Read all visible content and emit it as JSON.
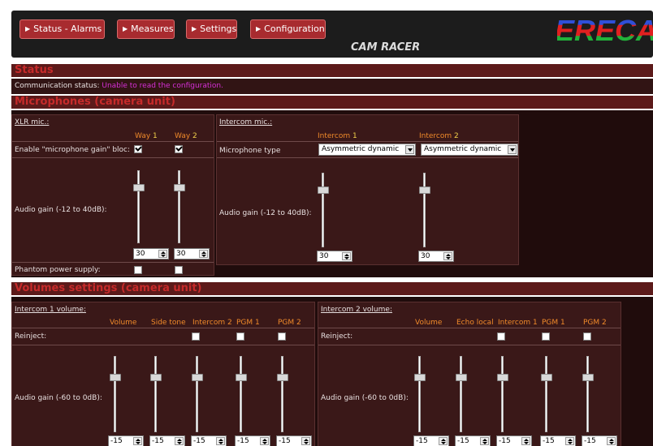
{
  "nav": {
    "status_alarms": "Status - Alarms",
    "measures": "Measures",
    "settings": "Settings",
    "configuration": "Configuration"
  },
  "header": {
    "device_name": "CAM RACER",
    "logo_text": "ERECA",
    "logo_colors": [
      "#2f4fd8",
      "#e02020",
      "#22b23a"
    ]
  },
  "status": {
    "section_title": "Status",
    "comm_label": "Communication status:",
    "comm_value": "Unable to read the configuration."
  },
  "microphones": {
    "section_title": "Microphones (camera unit)",
    "xlr": {
      "title": "XLR mic.:",
      "col_way1_prefix": "Way",
      "col_way1_num": "1",
      "col_way2_prefix": "Way",
      "col_way2_num": "2",
      "enable_label": "Enable \"microphone gain\" bloc:",
      "enable_way1": true,
      "enable_way2": true,
      "gain_label": "Audio gain (-12 to 40dB):",
      "gain_way1": "30",
      "gain_way2": "30",
      "phantom_label": "Phantom power supply:",
      "phantom_way1": false,
      "phantom_way2": false
    },
    "intercom": {
      "title": "Intercom mic.:",
      "col1_prefix": "Intercom",
      "col1_num": "1",
      "col2_prefix": "Intercom",
      "col2_num": "2",
      "type_label": "Microphone type",
      "type1": "Asymmetric dynamic",
      "type2": "Asymmetric dynamic",
      "gain_label": "Audio gain (-12 to 40dB):",
      "gain1": "30",
      "gain2": "30"
    }
  },
  "volumes": {
    "section_title": "Volumes settings (camera unit)",
    "ic1": {
      "title": "Intercom 1 volume:",
      "cols": [
        "Volume",
        "Side tone",
        "Intercom 2",
        "PGM 1",
        "PGM 2"
      ],
      "reinject_label": "Reinject:",
      "gain_label": "Audio gain (-60 to 0dB):",
      "values": [
        "-15",
        "-15",
        "-15",
        "-15",
        "-15"
      ]
    },
    "ic2": {
      "title": "Intercom 2 volume:",
      "cols": [
        "Volume",
        "Echo local",
        "Intercom 1",
        "PGM 1",
        "PGM 2"
      ],
      "reinject_label": "Reinject:",
      "gain_label": "Audio gain (-60 to 0dB):",
      "values": [
        "-15",
        "-15",
        "-15",
        "-15",
        "-15"
      ]
    }
  }
}
